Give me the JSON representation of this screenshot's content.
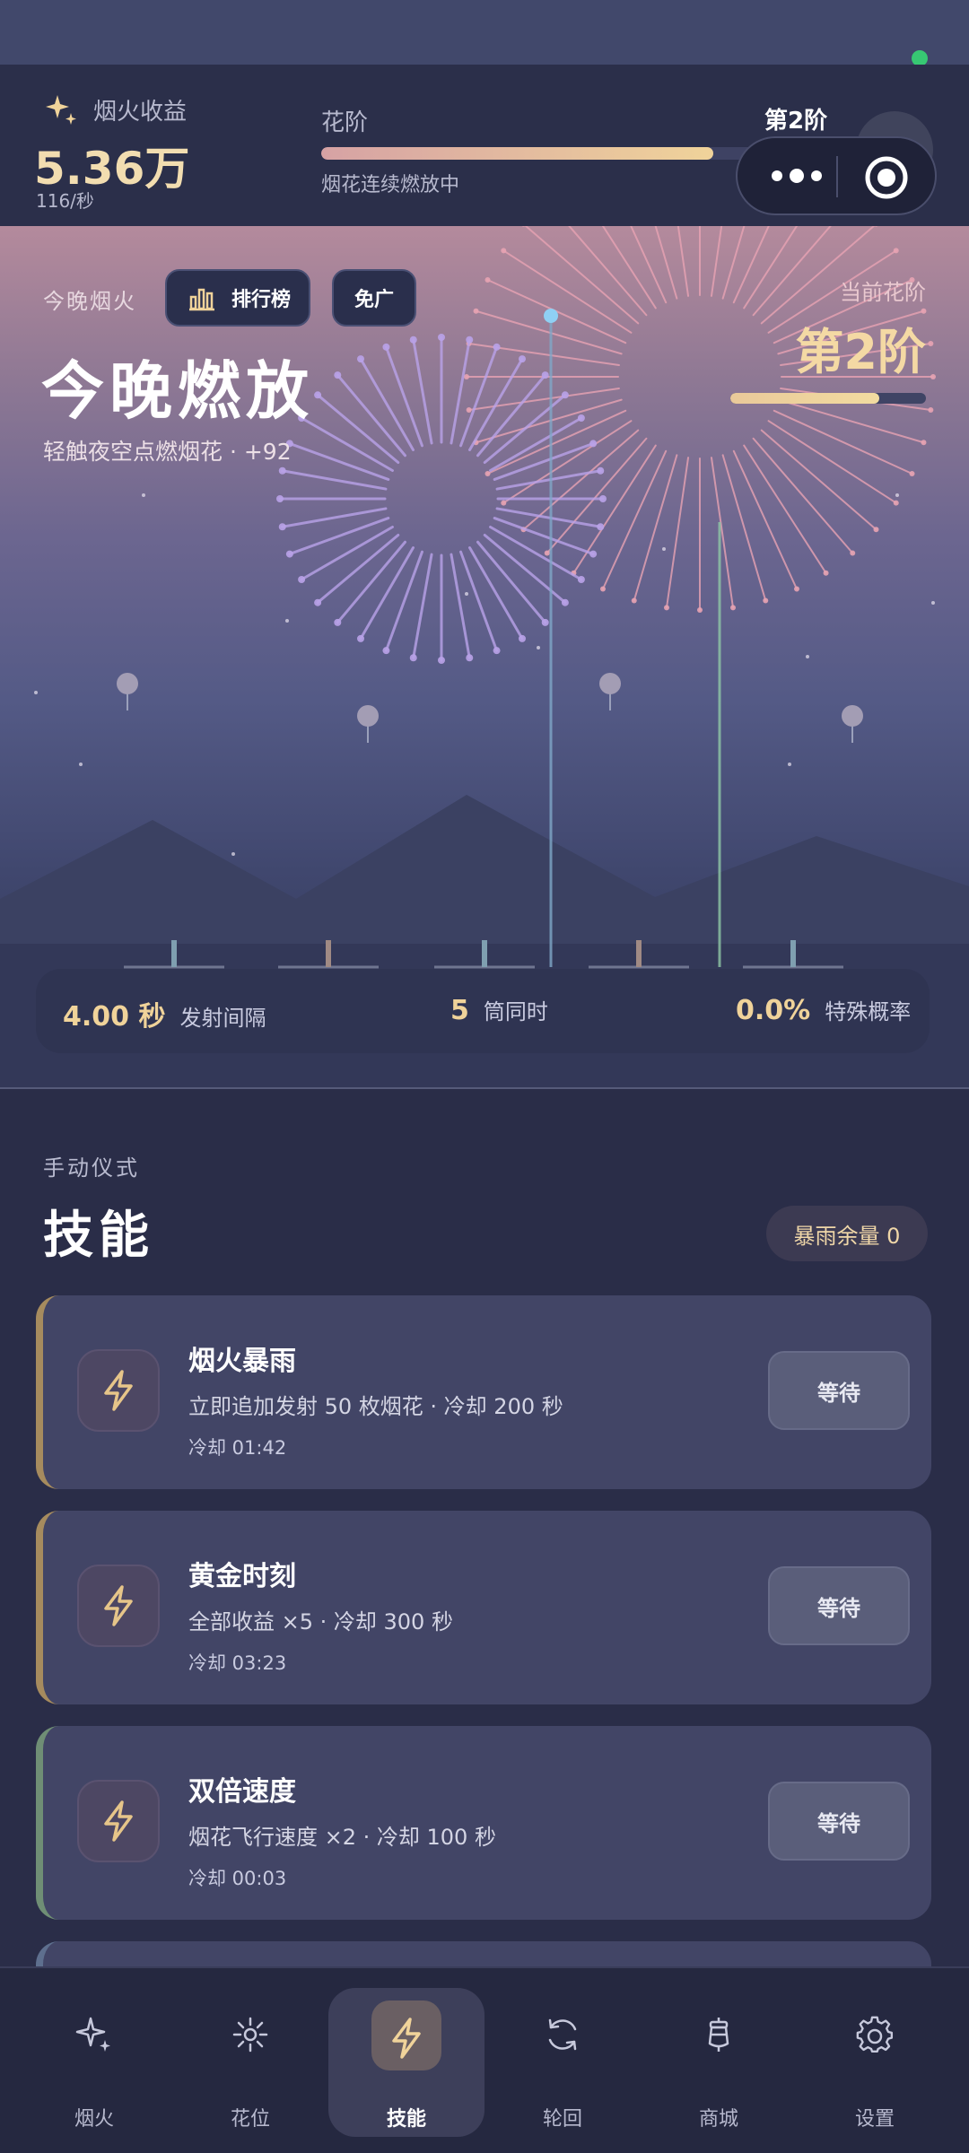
{
  "header": {
    "income_label": "烟火收益",
    "income_value": "5.36万",
    "income_rate": "116/秒",
    "tier_label": "花阶",
    "tier_badge": "第2阶",
    "tier_status": "烟花连续燃放中",
    "tier_progress": 0.78
  },
  "hero": {
    "subtitle": "今晚烟火",
    "leaderboard_label": "排行榜",
    "ad_free_label": "免广",
    "title": "今晚燃放",
    "description": "轻触夜空点燃烟花 · +92",
    "current_tier_label": "当前花阶",
    "current_tier_value": "第2阶",
    "current_tier_progress": 0.76
  },
  "stats": [
    {
      "value": "4.00 秒",
      "label": "发射间隔"
    },
    {
      "value": "5",
      "label": "筒同时"
    },
    {
      "value": "0.0%",
      "label": "特殊概率"
    }
  ],
  "skills_section": {
    "kicker": "手动仪式",
    "title": "技能",
    "rain_remaining": "暴雨余量 0"
  },
  "skills": [
    {
      "name": "烟火暴雨",
      "desc": "立即追加发射 50 枚烟花 · 冷却 200 秒",
      "cooldown": "冷却 01:42",
      "button": "等待",
      "accent": "#a68b5e"
    },
    {
      "name": "黄金时刻",
      "desc": "全部收益 ×5 · 冷却 300 秒",
      "cooldown": "冷却 03:23",
      "button": "等待",
      "accent": "#a68b5e"
    },
    {
      "name": "双倍速度",
      "desc": "烟花飞行速度 ×2 · 冷却 100 秒",
      "cooldown": "冷却 00:03",
      "button": "等待",
      "accent": "#6f8e75"
    }
  ],
  "tabs": [
    {
      "label": "烟火",
      "icon": "sparkle-icon"
    },
    {
      "label": "花位",
      "icon": "burst-icon"
    },
    {
      "label": "技能",
      "icon": "lightning-icon",
      "active": true
    },
    {
      "label": "轮回",
      "icon": "refresh-icon"
    },
    {
      "label": "商城",
      "icon": "lantern-icon"
    },
    {
      "label": "设置",
      "icon": "gear-icon"
    }
  ],
  "colors": {
    "accent_gold": "#f0d39a",
    "background": "#2a2d48",
    "status_online": "#37c873"
  }
}
